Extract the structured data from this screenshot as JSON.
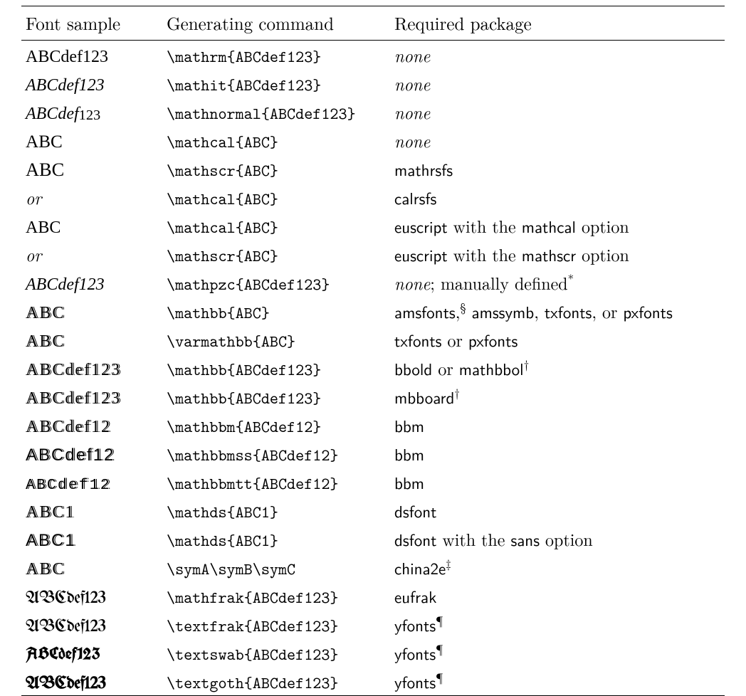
{
  "headers": {
    "col1": "Font sample",
    "col2": "Generating command",
    "col3": "Required package"
  },
  "rows": [
    {
      "sample": {
        "class": "samp-rm",
        "html": "ABCdef123"
      },
      "command": "\\mathrm{ABCdef123}",
      "package": [
        {
          "t": "none",
          "style": "it"
        }
      ]
    },
    {
      "sample": {
        "class": "samp-it",
        "html": "ABCdef123"
      },
      "command": "\\mathit{ABCdef123}",
      "package": [
        {
          "t": "none",
          "style": "it"
        }
      ]
    },
    {
      "sample": {
        "class": "samp-normal",
        "html": "ABCdef<span class=\"dig\">123</span>"
      },
      "command": "\\mathnormal{ABCdef123}",
      "package": [
        {
          "t": "none",
          "style": "it"
        }
      ]
    },
    {
      "sample": {
        "class": "samp-cal",
        "html": "ABC"
      },
      "command": "\\mathcal{ABC}",
      "package": [
        {
          "t": "none",
          "style": "it"
        }
      ]
    },
    {
      "sample": {
        "class": "samp-scr",
        "html": "ABC"
      },
      "command": "\\mathscr{ABC}",
      "package": [
        {
          "t": "mathrsfs",
          "style": "sf"
        }
      ]
    },
    {
      "sample": {
        "or": true
      },
      "command": "\\mathcal{ABC}",
      "package": [
        {
          "t": "calrsfs",
          "style": "sf"
        }
      ]
    },
    {
      "sample": {
        "class": "samp-eus",
        "html": "ABC"
      },
      "command": "\\mathcal{ABC}",
      "package": [
        {
          "t": "euscript",
          "style": "sf"
        },
        {
          "t": " with the ",
          "style": ""
        },
        {
          "t": "mathcal",
          "style": "sf"
        },
        {
          "t": " option",
          "style": ""
        }
      ]
    },
    {
      "sample": {
        "or": true
      },
      "command": "\\mathscr{ABC}",
      "package": [
        {
          "t": "euscript",
          "style": "sf"
        },
        {
          "t": " with the ",
          "style": ""
        },
        {
          "t": "mathscr",
          "style": "sf"
        },
        {
          "t": " option",
          "style": ""
        }
      ]
    },
    {
      "sample": {
        "class": "samp-pzc",
        "html": "ABCdef123"
      },
      "command": "\\mathpzc{ABCdef123}",
      "package": [
        {
          "t": "none",
          "style": "it"
        },
        {
          "t": "; manually defined",
          "style": ""
        },
        {
          "t": "*",
          "style": "sup"
        }
      ]
    },
    {
      "sample": {
        "class": "samp-bb",
        "html": "ABC"
      },
      "command": "\\mathbb{ABC}",
      "package": [
        {
          "t": "amsfonts",
          "style": "sf"
        },
        {
          "t": ",",
          "style": ""
        },
        {
          "t": "§",
          "style": "sup"
        },
        {
          "t": " ",
          "style": ""
        },
        {
          "t": "amssymb",
          "style": "sf"
        },
        {
          "t": ", ",
          "style": ""
        },
        {
          "t": "txfonts",
          "style": "sf"
        },
        {
          "t": ", or ",
          "style": ""
        },
        {
          "t": "pxfonts",
          "style": "sf"
        }
      ]
    },
    {
      "sample": {
        "class": "samp-bb2",
        "html": "ABC"
      },
      "command": "\\varmathbb{ABC}",
      "package": [
        {
          "t": "txfonts",
          "style": "sf"
        },
        {
          "t": " or ",
          "style": ""
        },
        {
          "t": "pxfonts",
          "style": "sf"
        }
      ]
    },
    {
      "sample": {
        "class": "samp-bb3",
        "html": "ABCdef123"
      },
      "command": "\\mathbb{ABCdef123}",
      "package": [
        {
          "t": "bbold",
          "style": "sf"
        },
        {
          "t": " or ",
          "style": ""
        },
        {
          "t": "mathbbol",
          "style": "sf"
        },
        {
          "t": "†",
          "style": "sup"
        }
      ]
    },
    {
      "sample": {
        "class": "samp-bb4",
        "html": "ABCdef123"
      },
      "command": "\\mathbb{ABCdef123}",
      "package": [
        {
          "t": "mbboard",
          "style": "sf"
        },
        {
          "t": "†",
          "style": "sup"
        }
      ]
    },
    {
      "sample": {
        "class": "samp-bbm",
        "html": "ABCdef12"
      },
      "command": "\\mathbbm{ABCdef12}",
      "package": [
        {
          "t": "bbm",
          "style": "sf"
        }
      ]
    },
    {
      "sample": {
        "class": "samp-bbmss",
        "html": "ABCdef12"
      },
      "command": "\\mathbbmss{ABCdef12}",
      "package": [
        {
          "t": "bbm",
          "style": "sf"
        }
      ]
    },
    {
      "sample": {
        "class": "samp-bbmtt",
        "html": "ABCdef12"
      },
      "command": "\\mathbbmtt{ABCdef12}",
      "package": [
        {
          "t": "bbm",
          "style": "sf"
        }
      ]
    },
    {
      "sample": {
        "class": "samp-ds",
        "html": "ABC1"
      },
      "command": "\\mathds{ABC1}",
      "package": [
        {
          "t": "dsfont",
          "style": "sf"
        }
      ]
    },
    {
      "sample": {
        "class": "samp-dss",
        "html": "ABC1"
      },
      "command": "\\mathds{ABC1}",
      "package": [
        {
          "t": "dsfont",
          "style": "sf"
        },
        {
          "t": " with the ",
          "style": ""
        },
        {
          "t": "sans",
          "style": "sf"
        },
        {
          "t": " option",
          "style": ""
        }
      ]
    },
    {
      "sample": {
        "class": "samp-ch",
        "html": "ABC"
      },
      "command": "\\symA\\symB\\symC",
      "package": [
        {
          "t": "china2e",
          "style": "sf"
        },
        {
          "t": "‡",
          "style": "sup"
        }
      ]
    },
    {
      "sample": {
        "class": "samp-frak",
        "html": "ABCdef123"
      },
      "command": "\\mathfrak{ABCdef123}",
      "package": [
        {
          "t": "eufrak",
          "style": "sf"
        }
      ]
    },
    {
      "sample": {
        "class": "samp-tfrak",
        "html": "ABCdef123"
      },
      "command": "\\textfrak{ABCdef123}",
      "package": [
        {
          "t": "yfonts",
          "style": "sf"
        },
        {
          "t": "¶",
          "style": "sup"
        }
      ]
    },
    {
      "sample": {
        "class": "samp-swab",
        "html": "ABCdef123"
      },
      "command": "\\textswab{ABCdef123}",
      "package": [
        {
          "t": "yfonts",
          "style": "sf"
        },
        {
          "t": "¶",
          "style": "sup"
        }
      ]
    },
    {
      "sample": {
        "class": "samp-goth",
        "html": "ABCdef123"
      },
      "command": "\\textgoth{ABCdef123}",
      "package": [
        {
          "t": "yfonts",
          "style": "sf"
        },
        {
          "t": "¶",
          "style": "sup"
        }
      ]
    }
  ],
  "labels": {
    "or": "or"
  }
}
